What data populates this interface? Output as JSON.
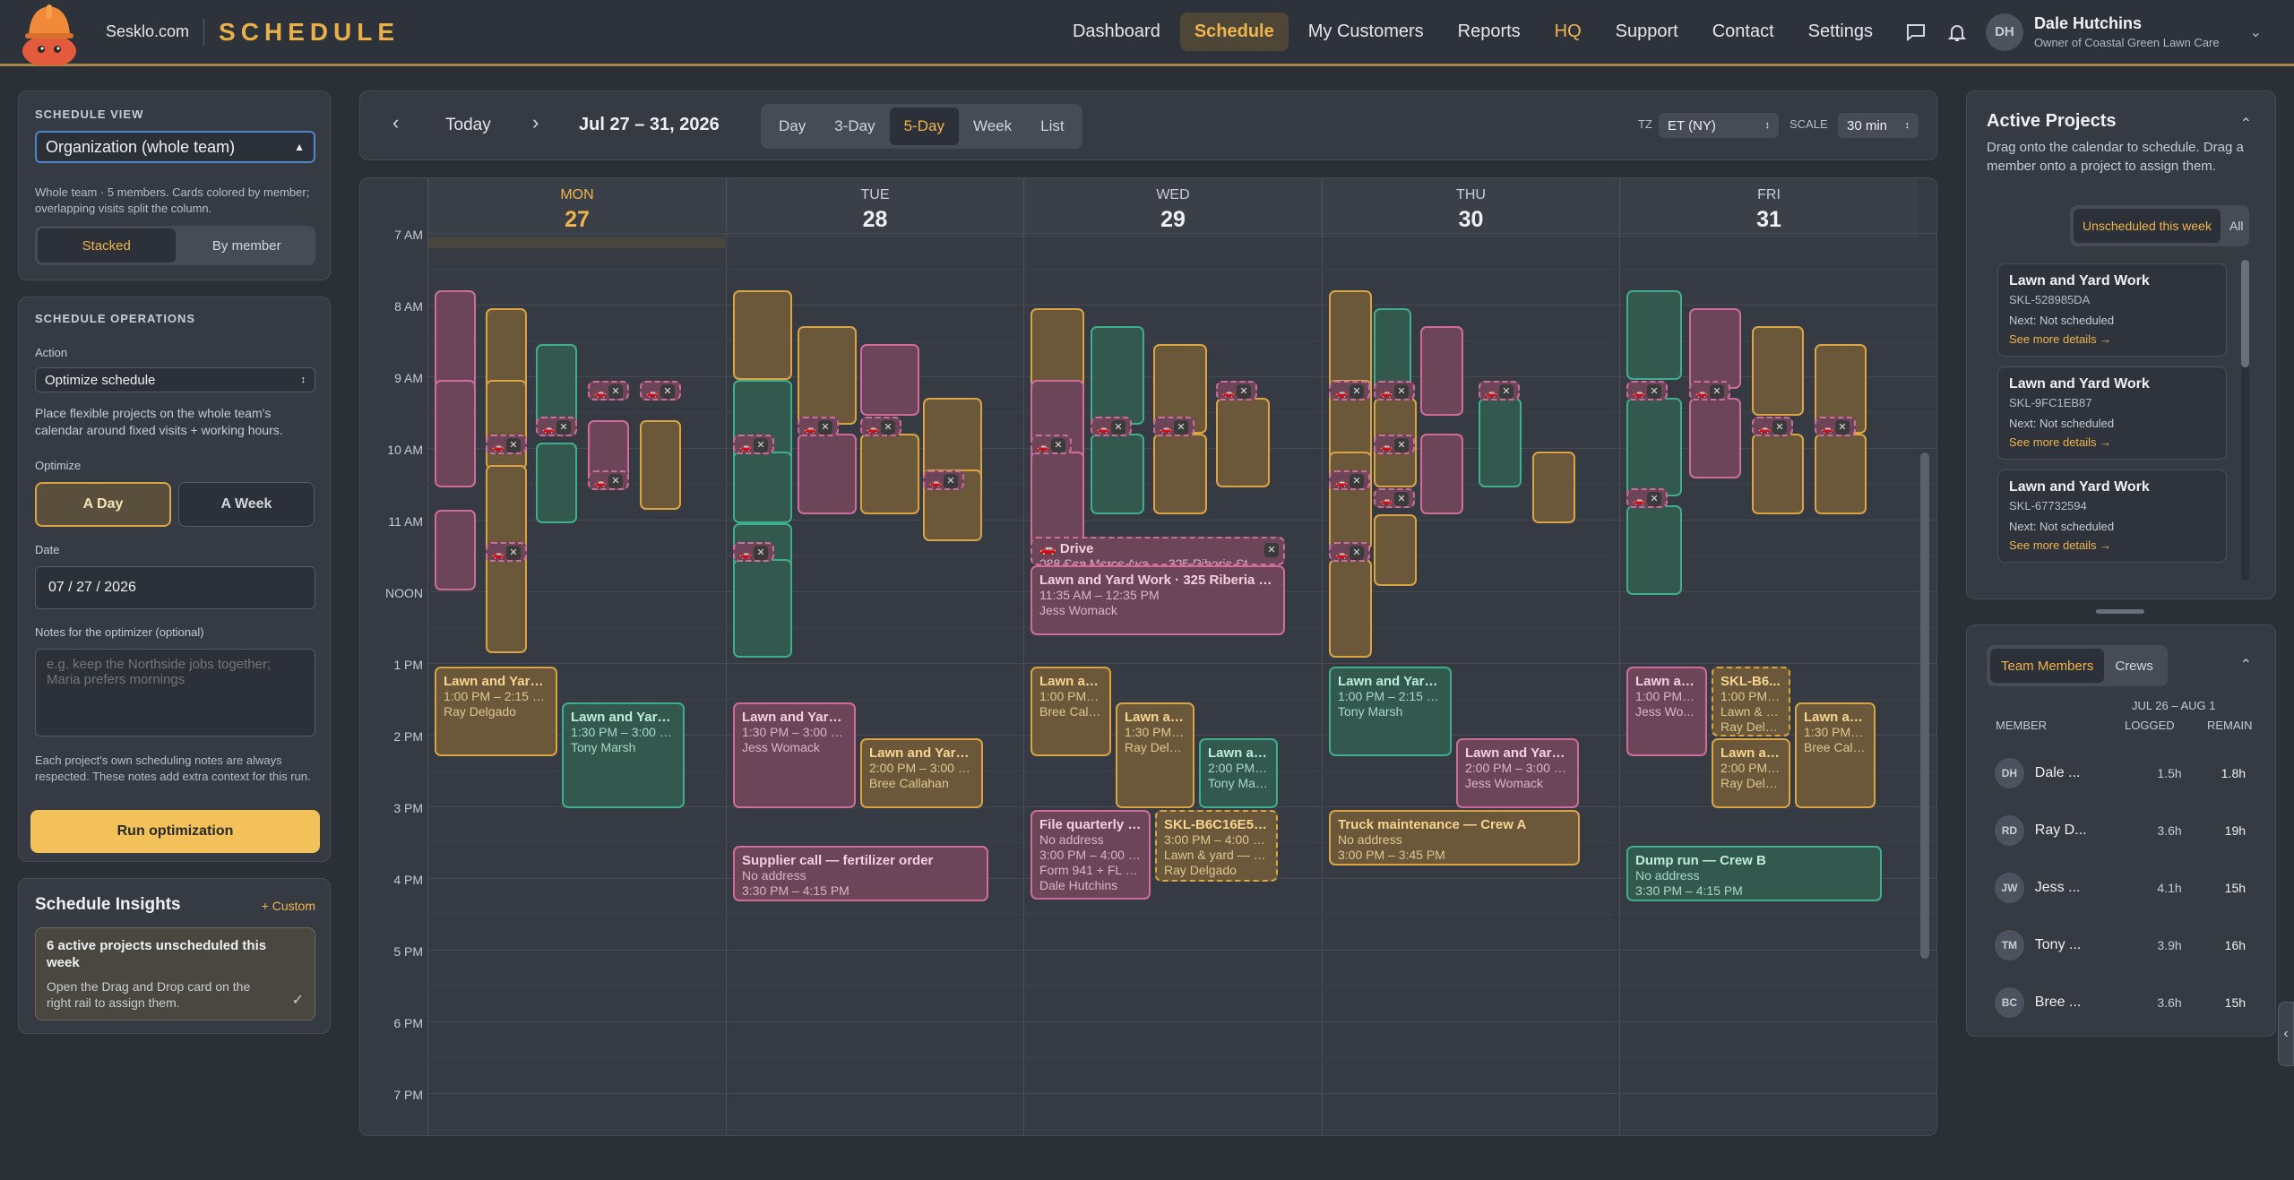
{
  "header": {
    "brand": "Sesklo.com",
    "title": "SCHEDULE",
    "nav": [
      "Dashboard",
      "Schedule",
      "My Customers",
      "Reports",
      "HQ",
      "Support",
      "Contact",
      "Settings"
    ],
    "user": {
      "initials": "DH",
      "name": "Dale Hutchins",
      "role": "Owner of Coastal Green Lawn Care"
    }
  },
  "left": {
    "view": {
      "section": "SCHEDULE VIEW",
      "select": "Organization (whole team)",
      "help": "Whole team · 5 members. Cards colored by member; overlapping visits split the column.",
      "seg": [
        "Stacked",
        "By member"
      ]
    },
    "ops": {
      "section": "SCHEDULE OPERATIONS",
      "action_label": "Action",
      "action": "Optimize schedule",
      "help": "Place flexible projects on the whole team's calendar around fixed visits + working hours.",
      "optimize_label": "Optimize",
      "opt_seg": [
        "A Day",
        "A Week"
      ],
      "date_label": "Date",
      "date": "07 / 27 / 2026",
      "notes_label": "Notes for the optimizer (optional)",
      "notes_placeholder": "e.g. keep the Northside jobs together; Maria prefers mornings",
      "notes_help": "Each project's own scheduling notes are always respected. These notes add extra context for this run.",
      "run": "Run optimization"
    },
    "insights": {
      "title": "Schedule Insights",
      "custom": "+ Custom",
      "card_title": "6 active projects unscheduled this week",
      "card_text": "Open the Drag and Drop card on the right rail to assign them."
    }
  },
  "toolbar": {
    "today": "Today",
    "range": "Jul 27 – 31, 2026",
    "views": [
      "Day",
      "3-Day",
      "5-Day",
      "Week",
      "List"
    ],
    "tz_label": "TZ",
    "tz": "ET (NY)",
    "scale_label": "SCALE",
    "scale": "30 min"
  },
  "calendar": {
    "days": [
      {
        "name": "MON",
        "date": "27"
      },
      {
        "name": "TUE",
        "date": "28"
      },
      {
        "name": "WED",
        "date": "29"
      },
      {
        "name": "THU",
        "date": "30"
      },
      {
        "name": "FRI",
        "date": "31"
      }
    ],
    "hours": [
      "7 AM",
      "8 AM",
      "9 AM",
      "10 AM",
      "11 AM",
      "NOON",
      "1 PM",
      "2 PM",
      "3 PM",
      "4 PM",
      "5 PM",
      "6 PM",
      "7 PM"
    ],
    "events": {
      "mon1": {
        "t": "Lawn and Yard ...",
        "s1": "1:00 PM – 2:15 PM",
        "s2": "Ray Delgado"
      },
      "mon2": {
        "t": "Lawn and Yard ...",
        "s1": "1:30 PM – 3:00 PM",
        "s2": "Tony Marsh"
      },
      "tue1": {
        "t": "Lawn and Yard ...",
        "s1": "1:30 PM – 3:00 PM",
        "s2": "Jess Womack"
      },
      "tue2": {
        "t": "Lawn and Yard ...",
        "s1": "2:00 PM – 3:00 P...",
        "s2": "Bree Callahan"
      },
      "tue3": {
        "t": "Supplier call — fertilizer order",
        "s1": "No address",
        "s2": "3:30 PM – 4:15 PM"
      },
      "wed_drive": {
        "t": "Drive",
        "s1": "288 San Marco Ave → 325 Riberia St"
      },
      "wed_big": {
        "t": "Lawn and Yard Work · 325 Riberia St,...",
        "s1": "11:35 AM – 12:35 PM",
        "s2": "Jess Womack"
      },
      "wed1": {
        "t": "Lawn an...",
        "s1": "1:00 PM – ...",
        "s2": "Bree Calla..."
      },
      "wed2": {
        "t": "Lawn an...",
        "s1": "1:30 PM – ...",
        "s2": "Ray Delga..."
      },
      "wed3": {
        "t": "Lawn an...",
        "s1": "2:00 PM – ...",
        "s2": "Tony Marsh"
      },
      "wed4": {
        "t": "File quarterly t...",
        "s1": "No address",
        "s2": "3:00 PM – 4:00 P...",
        "s3": "Form 941 + FL sal...",
        "s4": "Dale Hutchins"
      },
      "wed5": {
        "t": "SKL-B6C16E5F...",
        "s1": "3:00 PM – 4:00 P...",
        "s2": "Lawn & yard — Kim",
        "s3": "Ray Delgado"
      },
      "thu1": {
        "t": "Lawn and Yard ...",
        "s1": "1:00 PM – 2:15 PM",
        "s2": "Tony Marsh"
      },
      "thu2": {
        "t": "Lawn and Yard ...",
        "s1": "2:00 PM – 3:00 PM",
        "s2": "Jess Womack"
      },
      "thu3": {
        "t": "Truck maintenance — Crew A",
        "s1": "No address",
        "s2": "3:00 PM – 3:45 PM"
      },
      "fri1": {
        "t": "Lawn an...",
        "s1": "1:00 PM – ...",
        "s2": "Jess Wo..."
      },
      "fri2": {
        "t": "SKL-B6...",
        "s1": "1:00 PM – ...",
        "s2": "Lawn & ya...",
        "s3": "Ray Delga..."
      },
      "fri3": {
        "t": "Lawn an...",
        "s1": "1:30 PM – ...",
        "s2": "Bree Calla..."
      },
      "fri4": {
        "t": "Lawn an...",
        "s1": "2:00 PM – ...",
        "s2": "Ray Delga..."
      },
      "fri5": {
        "t": "Dump run — Crew B",
        "s1": "No address",
        "s2": "3:30 PM – 4:15 PM"
      }
    }
  },
  "projects": {
    "title": "Active Projects",
    "desc": "Drag onto the calendar to schedule. Drag a member onto a project to assign them.",
    "filters": [
      "Unscheduled this week",
      "All"
    ],
    "items": [
      {
        "title": "Lawn and Yard Work",
        "id": "SKL-528985DA",
        "next": "Next: Not scheduled",
        "link": "See more details →"
      },
      {
        "title": "Lawn and Yard Work",
        "id": "SKL-9FC1EB87",
        "next": "Next: Not scheduled",
        "link": "See more details →"
      },
      {
        "title": "Lawn and Yard Work",
        "id": "SKL-67732594",
        "next": "Next: Not scheduled",
        "link": "See more details →"
      }
    ]
  },
  "team": {
    "tabs": [
      "Team Members",
      "Crews"
    ],
    "range": "JUL 26 – AUG 1",
    "cols": [
      "MEMBER",
      "LOGGED",
      "REMAIN"
    ],
    "members": [
      {
        "i": "DH",
        "n": "Dale ...",
        "l": "1.5h",
        "r": "1.8h"
      },
      {
        "i": "RD",
        "n": "Ray D...",
        "l": "3.6h",
        "r": "19h"
      },
      {
        "i": "JW",
        "n": "Jess ...",
        "l": "4.1h",
        "r": "15h"
      },
      {
        "i": "TM",
        "n": "Tony ...",
        "l": "3.9h",
        "r": "16h"
      },
      {
        "i": "BC",
        "n": "Bree ...",
        "l": "3.6h",
        "r": "15h"
      }
    ]
  },
  "colors": {
    "accent": "#f0b44c",
    "orange": "#d9a544",
    "pink": "#cf6d9a",
    "green": "#3fae8c"
  }
}
